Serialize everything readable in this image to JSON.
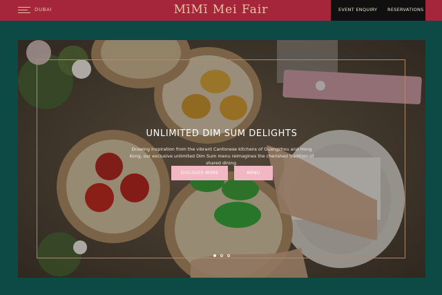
{
  "header": {
    "location": "DUBAI",
    "brand": "MīMī Mei Fair",
    "event_enquiry": "EVENT ENQUIRY",
    "reservations": "RESERVATIONS"
  },
  "hero": {
    "headline": "UNLIMITED DIM SUM DELIGHTS",
    "description": "Drawing inspiration from the vibrant Cantonese kitchens of Guangzhou and Hong Kong, our exclusive unlimited Dim Sum menu reimagines the cherished tradition of shared dining.",
    "discover_more": "DISCOVER MORE",
    "menu": "MENU",
    "slide_count": 3,
    "active_slide": 1
  },
  "colors": {
    "header_bg": "#a5253b",
    "page_bg": "#0d4a46",
    "brand_gold": "#e9c6a6",
    "button_pink": "#f1b8c4"
  },
  "icons": [
    "hamburger-menu-icon"
  ]
}
